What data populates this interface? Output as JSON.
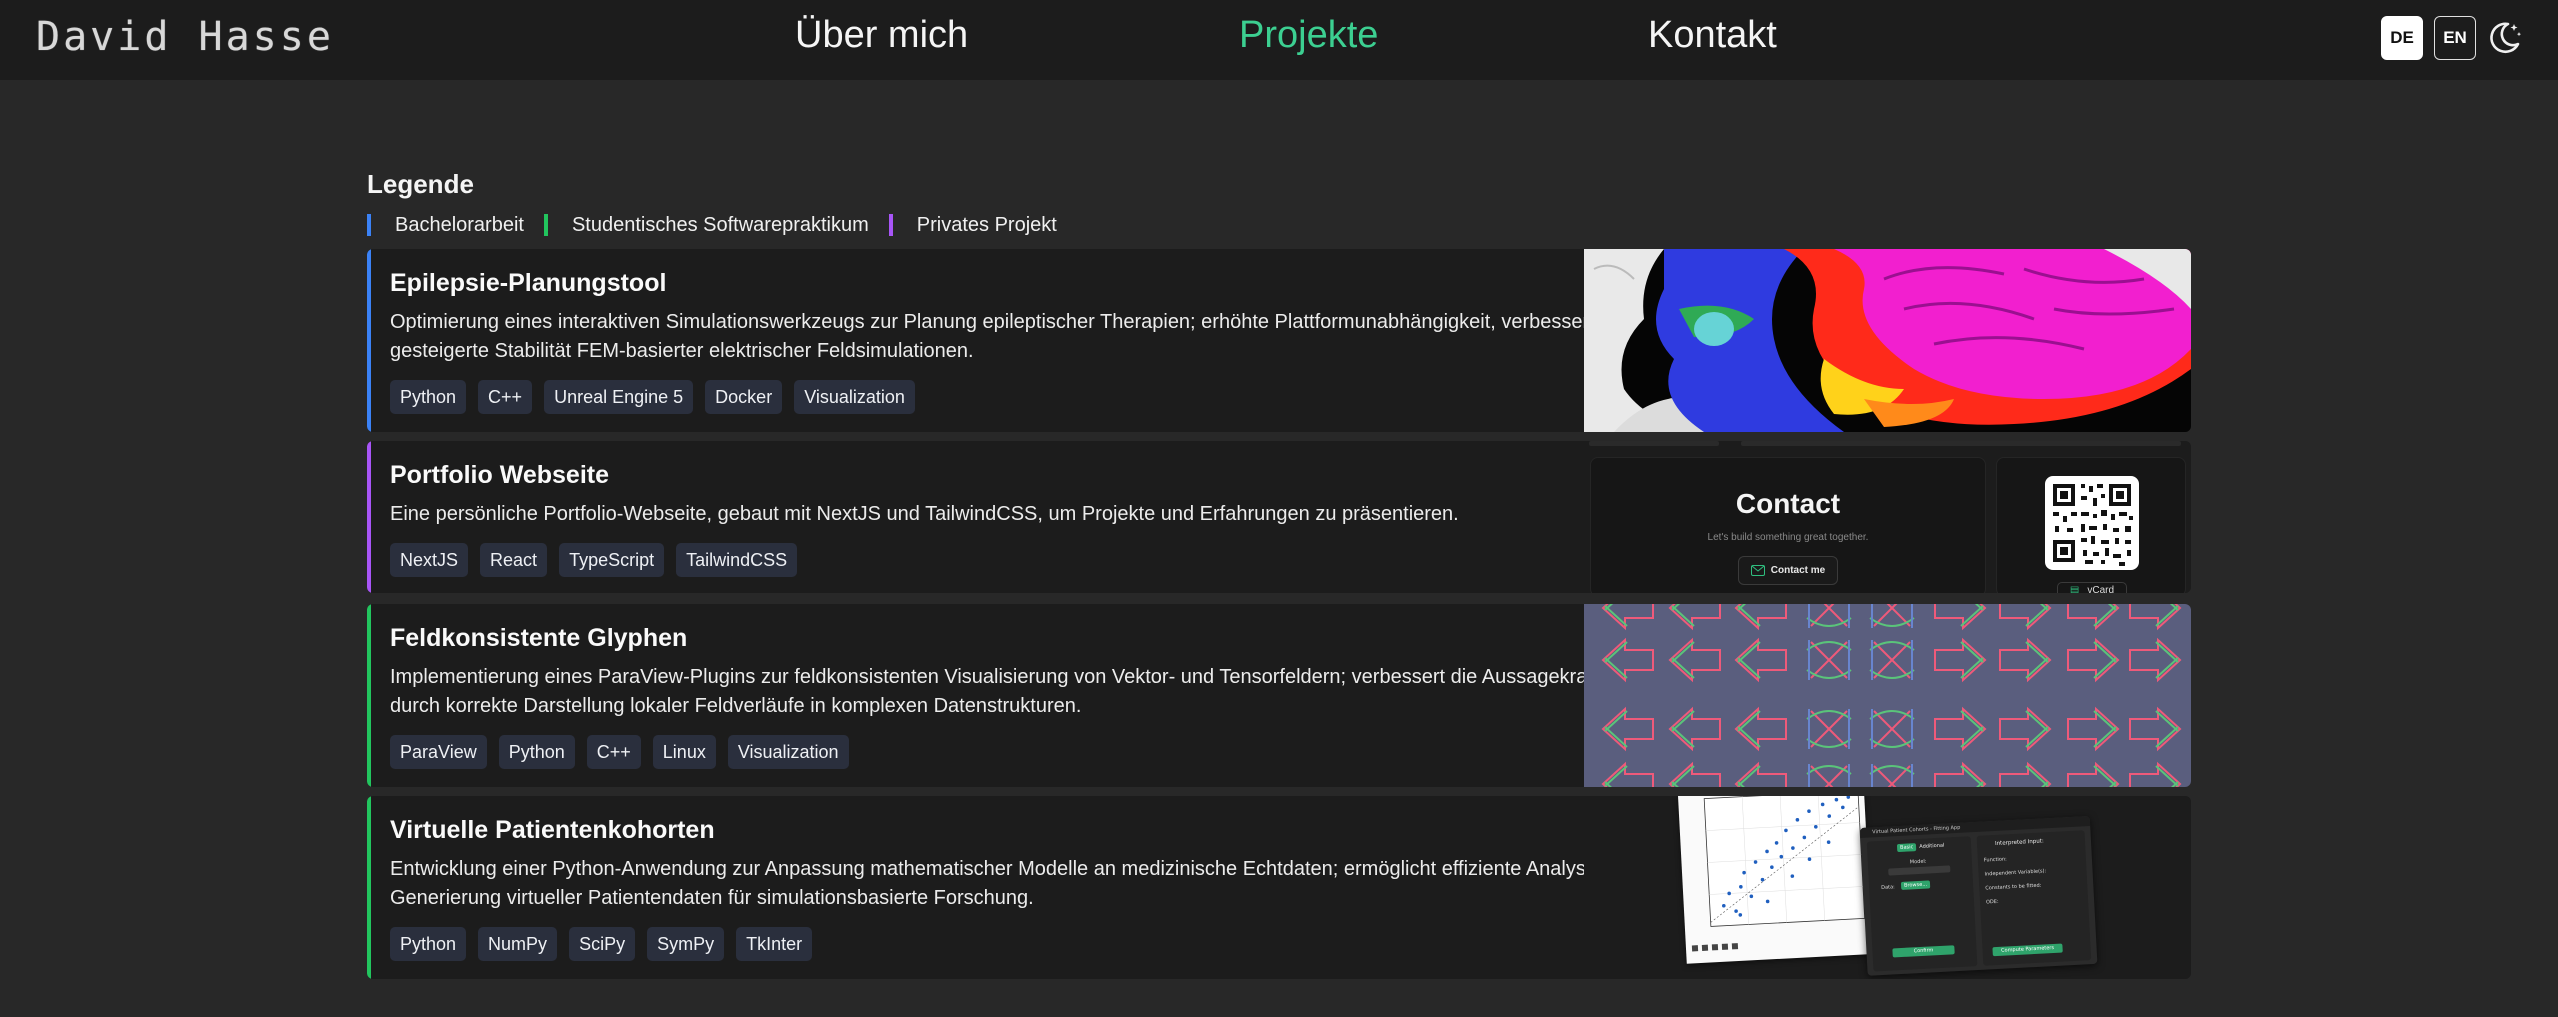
{
  "header": {
    "logo": "David Hasse",
    "nav": [
      "Über mich",
      "Projekte",
      "Kontakt"
    ],
    "lang_de": "DE",
    "lang_en": "EN",
    "theme_icon": "moon-icon"
  },
  "legend": {
    "title": "Legende",
    "items": [
      {
        "label": "Bachelorarbeit",
        "color": "#3b82f6"
      },
      {
        "label": "Studentisches Softwarepraktikum",
        "color": "#22c55e"
      },
      {
        "label": "Privates Projekt",
        "color": "#a855f7"
      }
    ]
  },
  "projects": [
    {
      "title": "Epilepsie-Planungstool",
      "description": "Optimierung eines interaktiven Simulationswerkzeugs zur Planung epileptischer Therapien; erhöhte Plattformunabhängigkeit, verbesserte Datenvisualisierung und deutlich gesteigerte Stabilität FEM-basierter elektrischer Feldsimulationen.",
      "tags": [
        "Python",
        "C++",
        "Unreal Engine 5",
        "Docker",
        "Visualization"
      ],
      "accent": "#3b82f6"
    },
    {
      "title": "Portfolio Webseite",
      "description": "Eine persönliche Portfolio-Webseite, gebaut mit NextJS und TailwindCSS, um Projekte und Erfahrungen zu präsentieren.",
      "tags": [
        "NextJS",
        "React",
        "TypeScript",
        "TailwindCSS"
      ],
      "accent": "#a855f7",
      "preview": {
        "heading": "Contact",
        "subtitle": "Let's build something great together.",
        "button": "Contact me",
        "vcard": "vCard"
      }
    },
    {
      "title": "Feldkonsistente Glyphen",
      "description": "Implementierung eines ParaView-Plugins zur feldkonsistenten Visualisierung von Vektor- und Tensorfeldern; verbessert die Aussagekraft wissenschaftlicher Visualisierungen durch korrekte Darstellung lokaler Feldverläufe in komplexen Datenstrukturen.",
      "tags": [
        "ParaView",
        "Python",
        "C++",
        "Linux",
        "Visualization"
      ],
      "accent": "#22c55e"
    },
    {
      "title": "Virtuelle Patientenkohorten",
      "description": "Entwicklung einer Python-Anwendung zur Anpassung mathematischer Modelle an medizinische Echtdaten; ermöglicht effiziente Analyse von Therapieeffekten und Generierung virtueller Patientendaten für simulationsbasierte Forschung.",
      "tags": [
        "Python",
        "NumPy",
        "SciPy",
        "SymPy",
        "TkInter"
      ],
      "accent": "#22c55e",
      "preview": {
        "window_title": "Virtual Patient Cohorts - Fitting App",
        "tab_basic": "Basic",
        "tab_additional": "Additional",
        "model_label": "Model:",
        "data_label": "Data:",
        "browse": "Browse...",
        "confirm": "Confirm",
        "interpreted": "Interpreted Input:",
        "function": "Function:",
        "independent": "Independent Variable(s):",
        "constants": "Constants to be fitted:",
        "ode": "ODE:",
        "compute": "Compute Parameters"
      }
    }
  ]
}
